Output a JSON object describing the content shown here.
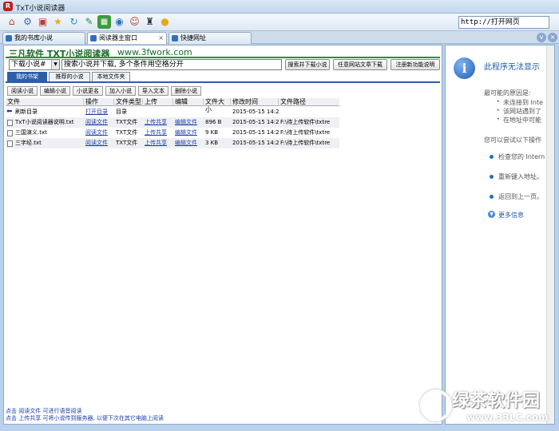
{
  "window": {
    "title": "TxT小说阅读器"
  },
  "toolbar": {
    "icons": [
      "home-icon",
      "settings-icon",
      "shop-icon",
      "star-icon",
      "refresh-icon",
      "tools-icon",
      "grid-icon",
      "play-icon",
      "user-icon",
      "tie-icon",
      "chat-icon"
    ],
    "url": "http://打开网页"
  },
  "tabs": [
    {
      "label": "我的书库小说"
    },
    {
      "label": "阅读器主窗口"
    },
    {
      "label": "快捷网址"
    }
  ],
  "main": {
    "brand": "三凡软件 TXT小说阅读器",
    "brand_url": "www.3fwork.com",
    "download_select": "下载小说#",
    "search_value": "搜索小说并下载, 多个条件用空格分开",
    "buttons": {
      "search_download": "搜索并下载小说",
      "any_site": "任意网站文章下载",
      "register": "注册新功能说明"
    },
    "nav_tabs": [
      "我的书架",
      "推荐的小说",
      "本地文件夹"
    ],
    "actions": [
      "阅读小说",
      "编辑小说",
      "小说更名",
      "加入小说",
      "导入文本",
      "删除小说"
    ],
    "columns": [
      "文件",
      "操作",
      "文件类型",
      "上传",
      "编辑",
      "文件大小",
      "修改时间",
      "文件路径"
    ],
    "rows": [
      {
        "file": "刷新目录",
        "op": "打开目录",
        "type": "目录",
        "upload": "",
        "edit": "",
        "size": "",
        "time": "2015-05-15 14:29",
        "path": ""
      },
      {
        "file": "TxT小说阅读器说明.txt",
        "op": "阅读文件",
        "type": "TXT文件",
        "upload": "上传共享",
        "edit": "编辑文件",
        "size": "896 B",
        "time": "2015-05-15 14:29",
        "path": "F:\\待上传软件\\txtre"
      },
      {
        "file": "三国演义.txt",
        "op": "阅读文件",
        "type": "TXT文件",
        "upload": "上传共享",
        "edit": "编辑文件",
        "size": "9 KB",
        "time": "2015-05-15 14:29",
        "path": "F:\\待上传软件\\txtre"
      },
      {
        "file": "三字经.txt",
        "op": "阅读文件",
        "type": "TXT文件",
        "upload": "上传共享",
        "edit": "编辑文件",
        "size": "3 KB",
        "time": "2015-05-15 14:29",
        "path": "F:\\待上传软件\\txtre"
      }
    ],
    "status": [
      "点击 阅读文件 可进行语音阅读",
      "点击 上传共享 可将小说传到服务器, 以便下次在其它电脑上阅读"
    ]
  },
  "side": {
    "title": "此程序无法显示",
    "reasons_heading": "最可能的原因是:",
    "reasons": [
      "未连接到 Inte",
      "该网站遇到了",
      "在地址中可能"
    ],
    "try_heading": "您可以尝试以下操作",
    "actions": [
      "检查您的 Intern",
      "重新键入地址。",
      "返回到上一页。"
    ],
    "more": "更多信息"
  },
  "watermark": {
    "text": "绿茶软件园",
    "url": "www.33LC.com"
  },
  "colors": {
    "brand_green": "#1a6b2a",
    "nav_blue": "#2d5ea8",
    "link_blue": "#1c3ea8"
  }
}
